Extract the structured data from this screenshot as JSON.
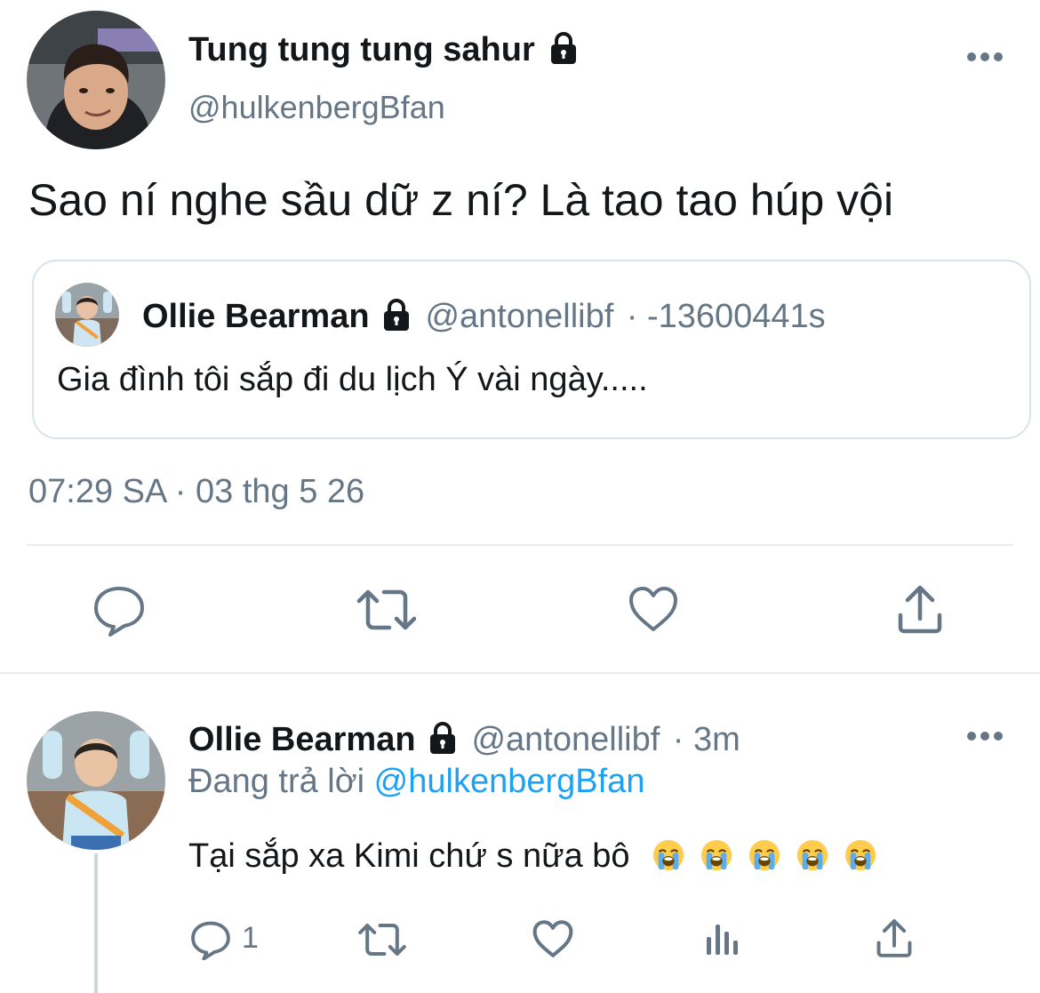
{
  "main_tweet": {
    "display_name": "Tung tung tung sahur",
    "handle": "@hulkenbergBfan",
    "text": "Sao ní nghe sầu dữ z ní? Là tao tao húp vội",
    "timestamp": "07:29 SA · 03 thg 5 26",
    "more_icon": "more-icon"
  },
  "quoted_tweet": {
    "display_name": "Ollie Bearman",
    "handle": "@antonellibf",
    "time": "· -13600441s",
    "text": "Gia đình tôi sắp đi du lịch Ý vài ngày....."
  },
  "actions": {
    "icons": [
      "reply-icon",
      "retweet-icon",
      "like-icon",
      "share-icon"
    ]
  },
  "reply": {
    "display_name": "Ollie Bearman",
    "handle": "@antonellibf",
    "time": "· 3m",
    "replying_prefix": "Đang trả lời",
    "replying_to": "@hulkenbergBfan",
    "text": "Tại sắp xa Kimi chứ s nữa bô",
    "emoji_count": 5,
    "emoji_name": "loudly-crying-face",
    "reply_count": "1",
    "icons": [
      "reply-icon",
      "retweet-icon",
      "like-icon",
      "analytics-icon",
      "share-icon"
    ]
  },
  "colors": {
    "text": "#14171a",
    "muted": "#657786",
    "accent": "#1da1f2",
    "divider": "#e6ecf0"
  }
}
